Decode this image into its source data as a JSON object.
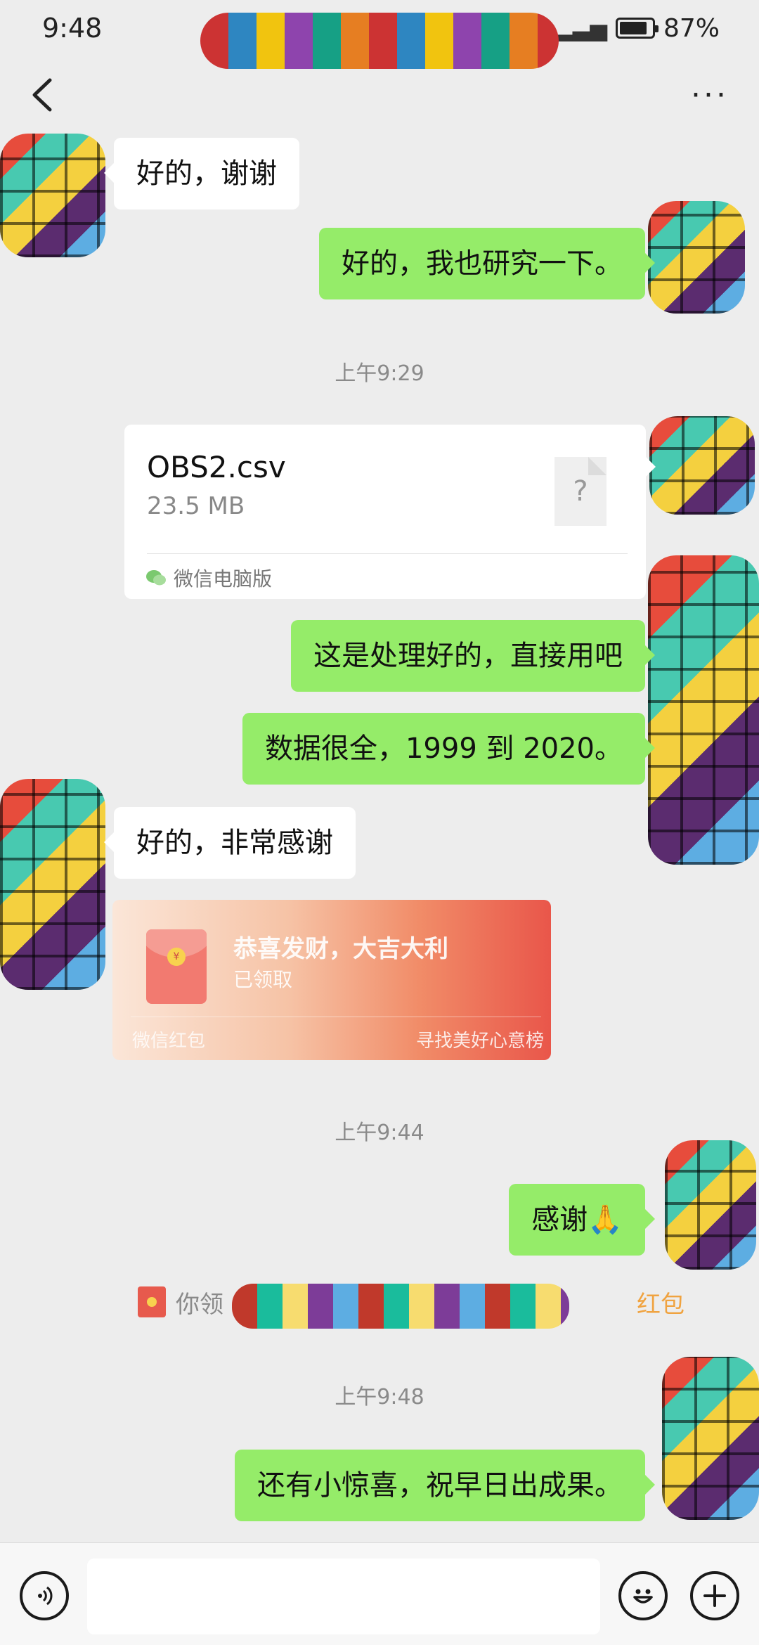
{
  "status_bar": {
    "time": "9:48",
    "battery": "87%",
    "battery_level": 0.87,
    "icons": [
      "eye-icon",
      "alarm-icon",
      "bluetooth-icon",
      "signal-4g-icon",
      "signal-4g-icon"
    ]
  },
  "nav": {
    "back": "<",
    "more": "···"
  },
  "messages": {
    "m1": "好的，谢谢",
    "m2": "好的，我也研究一下。",
    "m3": "这是处理好的，直接用吧",
    "m4": "数据很全，1999 到 2020。",
    "m5": "好的，非常感谢",
    "m6": "感谢🙏",
    "m7": "还有小惊喜，祝早日出成果。"
  },
  "timestamps": {
    "t1": "上午9:29",
    "t2": "上午9:44",
    "t3": "上午9:48"
  },
  "file": {
    "name": "OBS2.csv",
    "size": "23.5 MB",
    "icon_glyph": "?",
    "source": "微信电脑版"
  },
  "red_packet": {
    "title": "恭喜发财，大吉大利",
    "status": "已领取",
    "footer_left": "微信红包",
    "footer_right": "寻找美好心意榜"
  },
  "system_notice": {
    "prefix": "你领",
    "link": "红包"
  },
  "input_bar": {
    "placeholder": ""
  },
  "colors": {
    "background": "#ededed",
    "outgoing_bubble": "#95ec69",
    "incoming_bubble": "#ffffff",
    "accent_link": "#f0a340"
  }
}
